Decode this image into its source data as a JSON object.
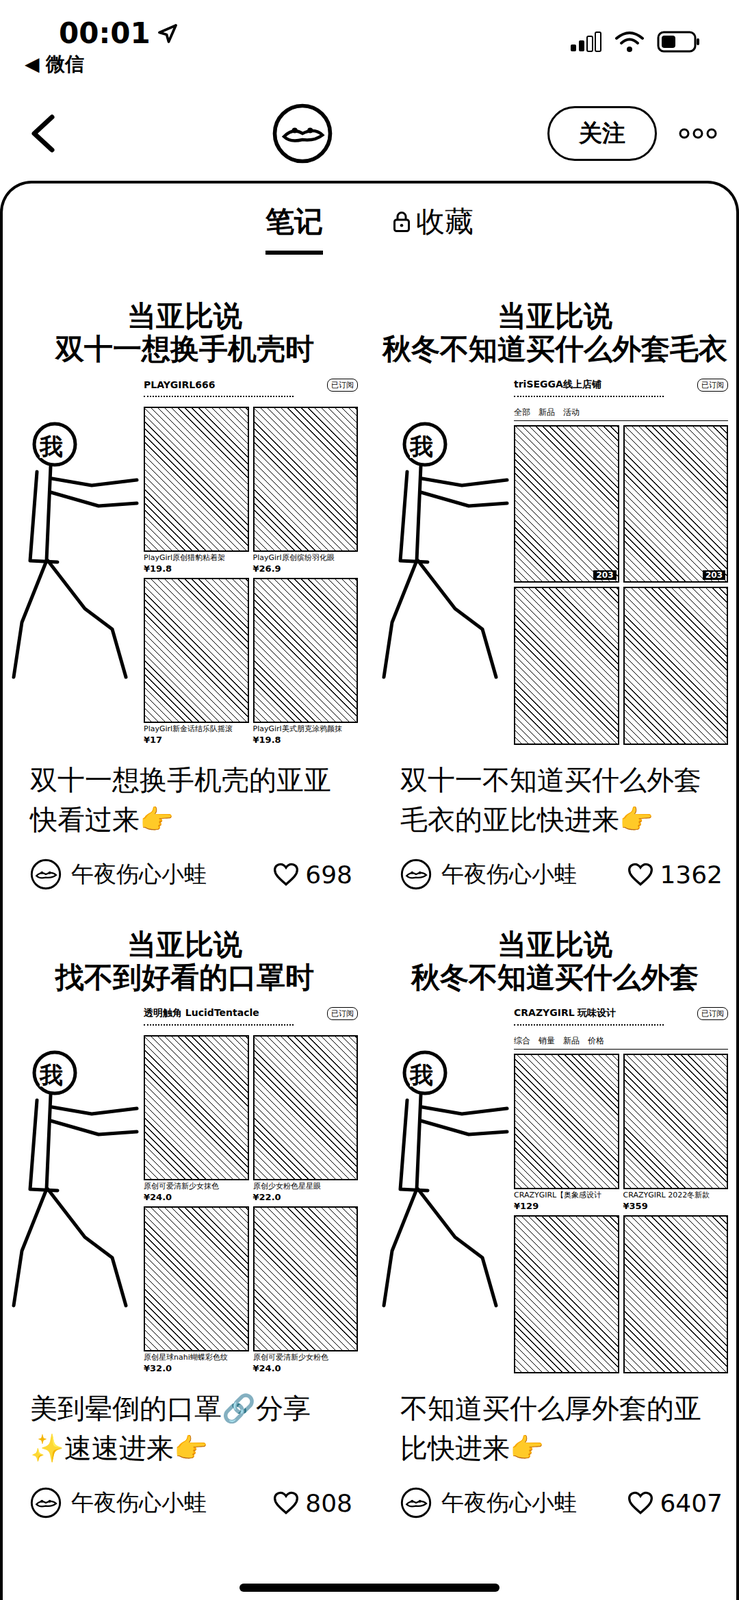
{
  "status_bar": {
    "time": "00:01",
    "back_app": "◀ 微信"
  },
  "header": {
    "follow_button": "关注"
  },
  "tabs": [
    {
      "label": "笔记",
      "selected": true,
      "locked": false
    },
    {
      "label": "收藏",
      "selected": false,
      "locked": true
    }
  ],
  "notes": [
    {
      "cover": {
        "headline": [
          "当亚比说",
          "双十一想换手机壳时"
        ],
        "figure_label": "我",
        "shop": {
          "name": "PLAYGIRL666",
          "badge": "已订阅",
          "tabs": [],
          "products": [
            {
              "name": "PlayGirl原创猎豹粘着架",
              "price": "¥19.8"
            },
            {
              "name": "PlayGirl原创缤纷羽化眼",
              "price": "¥26.9"
            },
            {
              "name": "PlayGirl新金话结乐队摇滚",
              "price": "¥17"
            },
            {
              "name": "PlayGirl美式朋克涂鸦颜抹",
              "price": "¥19.8"
            }
          ]
        }
      },
      "title": "双十一想换手机壳的亚亚快看过来👉",
      "author": "午夜伤心小蛙",
      "likes": "698",
      "liked": false
    },
    {
      "cover": {
        "headline": [
          "当亚比说",
          "秋冬不知道买什么外套毛衣"
        ],
        "figure_label": "我",
        "shop": {
          "name": "triSEGGA线上店铺",
          "badge": "已订阅",
          "tabs": [
            "全部",
            "新品",
            "活动"
          ],
          "products": [
            {
              "tag": "203"
            },
            {
              "tag": "203"
            },
            {},
            {}
          ]
        }
      },
      "title": "双十一不知道买什么外套毛衣的亚比快进来👉",
      "author": "午夜伤心小蛙",
      "likes": "1362",
      "liked": false
    },
    {
      "cover": {
        "headline": [
          "当亚比说",
          "找不到好看的口罩时"
        ],
        "figure_label": "我",
        "shop": {
          "name": "透明触角 LucidTentacle",
          "badge": "已订阅",
          "tabs": [],
          "products": [
            {
              "name": "原创可爱清新少女抹色",
              "price": "¥24.0"
            },
            {
              "name": "原创少女粉色星星眼",
              "price": "¥22.0"
            },
            {
              "name": "原创星球nahi蝴蝶彩色纹",
              "price": "¥32.0"
            },
            {
              "name": "原创可爱清新少女粉色",
              "price": "¥24.0"
            }
          ]
        }
      },
      "title": "美到晕倒的口罩🔗分享✨速速进来👉",
      "author": "午夜伤心小蛙",
      "likes": "808",
      "liked": false
    },
    {
      "cover": {
        "headline": [
          "当亚比说",
          "秋冬不知道买什么外套"
        ],
        "figure_label": "我",
        "shop": {
          "name": "CRAZYGIRL 玩味设计",
          "badge": "已订阅",
          "tabs": [
            "综合",
            "销量",
            "新品",
            "价格"
          ],
          "products": [
            {
              "name": "CRAZYGIRL【奥象感设计",
              "price": "¥129"
            },
            {
              "name": "CRAZYGIRL 2022冬新款",
              "price": "¥359"
            },
            {},
            {}
          ]
        }
      },
      "title": "不知道买什么厚外套的亚比快进来👉",
      "author": "午夜伤心小蛙",
      "likes": "6407",
      "liked": false
    }
  ]
}
